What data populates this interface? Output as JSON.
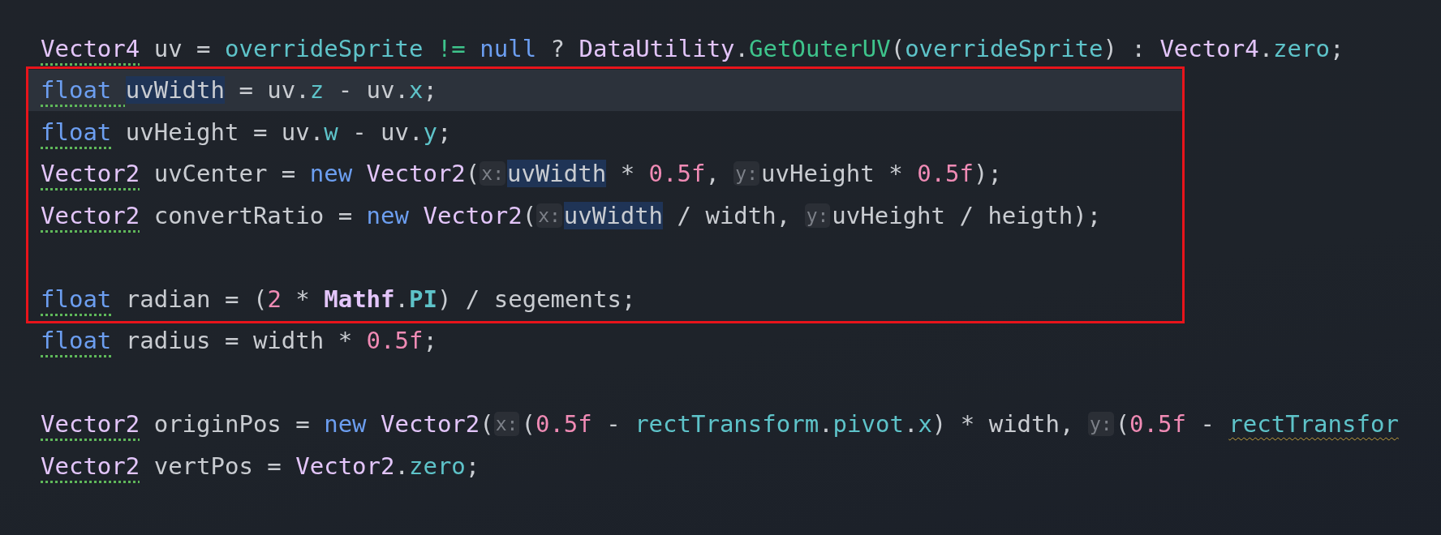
{
  "editor": {
    "sections": [
      {
        "boxed": false,
        "lines": [
          {
            "current": false,
            "tokens": [
              {
                "t": "Vector4",
                "kind": "type"
              },
              {
                "t": " uv = ",
                "kind": "plain"
              },
              {
                "t": "overrideSprite",
                "kind": "field"
              },
              {
                "t": " !=",
                "kind": "op"
              },
              {
                "t": " null",
                "kind": "keyword"
              },
              {
                "t": " ? ",
                "kind": "plain"
              },
              {
                "t": "DataUtility",
                "kind": "type"
              },
              {
                "t": ".",
                "kind": "plain"
              },
              {
                "t": "GetOuterUV",
                "kind": "method"
              },
              {
                "t": "(",
                "kind": "plain"
              },
              {
                "t": "overrideSprite",
                "kind": "field"
              },
              {
                "t": ") : ",
                "kind": "plain"
              },
              {
                "t": "Vector4",
                "kind": "type"
              },
              {
                "t": ".",
                "kind": "plain"
              },
              {
                "t": "zero",
                "kind": "field"
              },
              {
                "t": ";",
                "kind": "plain"
              }
            ]
          }
        ]
      },
      {
        "boxed": true,
        "lines": [
          {
            "current": true,
            "tokens": [
              {
                "t": "float ",
                "kind": "keyword"
              },
              {
                "t": "uvWidth",
                "kind": "ref"
              },
              {
                "t": " = uv.",
                "kind": "plain"
              },
              {
                "t": "z",
                "kind": "field"
              },
              {
                "t": " - uv.",
                "kind": "plain"
              },
              {
                "t": "x",
                "kind": "field"
              },
              {
                "t": ";",
                "kind": "plain"
              }
            ]
          },
          {
            "current": false,
            "tokens": [
              {
                "t": "float",
                "kind": "keyword"
              },
              {
                "t": " uvHeight = uv.",
                "kind": "plain"
              },
              {
                "t": "w",
                "kind": "field"
              },
              {
                "t": " - uv.",
                "kind": "plain"
              },
              {
                "t": "y",
                "kind": "field"
              },
              {
                "t": ";",
                "kind": "plain"
              }
            ]
          },
          {
            "current": false,
            "tokens": [
              {
                "t": "Vector2",
                "kind": "type"
              },
              {
                "t": " uvCenter = ",
                "kind": "plain"
              },
              {
                "t": "new",
                "kind": "keyword"
              },
              {
                "t": " Vector2",
                "kind": "type"
              },
              {
                "t": "(",
                "kind": "plain"
              },
              {
                "t": "x:",
                "kind": "hint"
              },
              {
                "t": "uvWidth",
                "kind": "ref"
              },
              {
                "t": " * ",
                "kind": "plain"
              },
              {
                "t": "0.5f",
                "kind": "number"
              },
              {
                "t": ", ",
                "kind": "plain"
              },
              {
                "t": "y:",
                "kind": "hint"
              },
              {
                "t": "uvHeight * ",
                "kind": "plain"
              },
              {
                "t": "0.5f",
                "kind": "number"
              },
              {
                "t": ");",
                "kind": "plain"
              }
            ]
          },
          {
            "current": false,
            "tokens": [
              {
                "t": "Vector2",
                "kind": "type"
              },
              {
                "t": " convertRatio = ",
                "kind": "plain"
              },
              {
                "t": "new",
                "kind": "keyword"
              },
              {
                "t": " Vector2",
                "kind": "type"
              },
              {
                "t": "(",
                "kind": "plain"
              },
              {
                "t": "x:",
                "kind": "hint"
              },
              {
                "t": "uvWidth",
                "kind": "ref"
              },
              {
                "t": " / width, ",
                "kind": "plain"
              },
              {
                "t": "y:",
                "kind": "hint"
              },
              {
                "t": "uvHeight / heigth);",
                "kind": "plain"
              }
            ]
          },
          {
            "current": false
          },
          {
            "current": false,
            "tokens": [
              {
                "t": "float",
                "kind": "keyword"
              },
              {
                "t": " radian = (",
                "kind": "plain"
              },
              {
                "t": "2",
                "kind": "number"
              },
              {
                "t": " * ",
                "kind": "plain"
              },
              {
                "t": "Mathf",
                "kind": "typebold"
              },
              {
                "t": ".",
                "kind": "plain"
              },
              {
                "t": "PI",
                "kind": "fieldbold"
              },
              {
                "t": ") / segements;",
                "kind": "plain"
              }
            ]
          }
        ]
      },
      {
        "boxed": false,
        "lines": [
          {
            "current": false,
            "tokens": [
              {
                "t": "float",
                "kind": "keyword"
              },
              {
                "t": " radius = width * ",
                "kind": "plain"
              },
              {
                "t": "0.5f",
                "kind": "number"
              },
              {
                "t": ";",
                "kind": "plain"
              }
            ]
          },
          {
            "current": false
          },
          {
            "current": false,
            "tokens": [
              {
                "t": "Vector2",
                "kind": "type"
              },
              {
                "t": " originPos = ",
                "kind": "plain"
              },
              {
                "t": "new",
                "kind": "keyword"
              },
              {
                "t": " Vector2",
                "kind": "type"
              },
              {
                "t": "(",
                "kind": "plain"
              },
              {
                "t": "x:",
                "kind": "hint"
              },
              {
                "t": "(",
                "kind": "plain"
              },
              {
                "t": "0.5f",
                "kind": "number"
              },
              {
                "t": " - ",
                "kind": "plain"
              },
              {
                "t": "rectTransform",
                "kind": "field"
              },
              {
                "t": ".",
                "kind": "plain"
              },
              {
                "t": "pivot",
                "kind": "field"
              },
              {
                "t": ".",
                "kind": "plain"
              },
              {
                "t": "x",
                "kind": "field"
              },
              {
                "t": ") * width, ",
                "kind": "plain"
              },
              {
                "t": "y:",
                "kind": "hint"
              },
              {
                "t": "(",
                "kind": "plain"
              },
              {
                "t": "0.5f",
                "kind": "number"
              },
              {
                "t": " - ",
                "kind": "plain"
              },
              {
                "t": "rectTransfor",
                "kind": "warnfield"
              }
            ]
          },
          {
            "current": false,
            "tokens": [
              {
                "t": "Vector2",
                "kind": "type"
              },
              {
                "t": " vertPos = ",
                "kind": "plain"
              },
              {
                "t": "Vector2",
                "kind": "type"
              },
              {
                "t": ".",
                "kind": "plain"
              },
              {
                "t": "zero",
                "kind": "field"
              },
              {
                "t": ";",
                "kind": "plain"
              }
            ]
          }
        ]
      }
    ]
  }
}
